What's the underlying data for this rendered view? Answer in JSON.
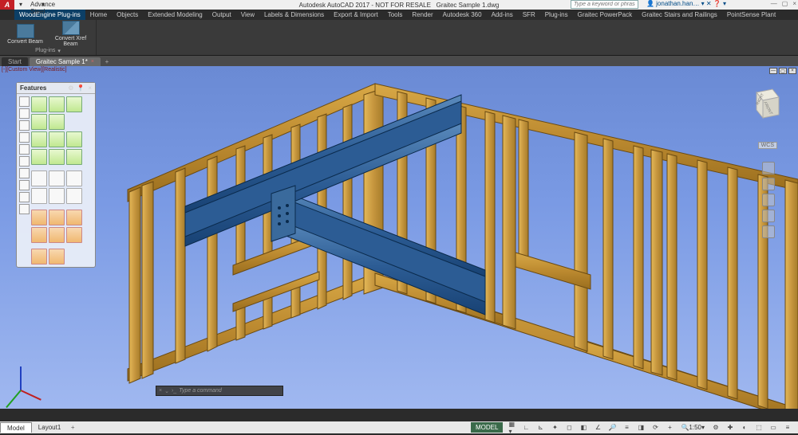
{
  "title": {
    "logo": "A",
    "qat_text": "Advance Steel",
    "app": "Autodesk AutoCAD 2017 - NOT FOR RESALE",
    "file": "Graitec Sample 1.dwg",
    "search_placeholder": "Type a keyword or phrase",
    "user": "jonathan.han…",
    "win_min": "—",
    "win_max": "▢",
    "win_close": "×"
  },
  "ribbon_tabs": [
    "WoodEngine Plug-ins",
    "Home",
    "Objects",
    "Extended Modeling",
    "Output",
    "View",
    "Labels & Dimensions",
    "Export & Import",
    "Tools",
    "Render",
    "Autodesk 360",
    "Add-ins",
    "SFR",
    "Plug-ins",
    "Graitec PowerPack",
    "Graitec Stairs and Railings",
    "PointSense Plant"
  ],
  "ribbon_tabs_active": 0,
  "ribbon": {
    "buttons": [
      {
        "label": "Convert Beam"
      },
      {
        "label": "Convert Xref Beam"
      }
    ],
    "panel_title": "Plug-ins",
    "panel_arrow": "▾"
  },
  "doc_tabs": {
    "items": [
      {
        "label": "Start",
        "active": false,
        "closable": false
      },
      {
        "label": "Graitec Sample 1*",
        "active": true,
        "closable": true
      }
    ],
    "plus": "+"
  },
  "viewport": {
    "controls": "[-][Custom View][Realistic]",
    "viewcube": {
      "front": "FRONT",
      "right": "RIGHT",
      "top": ""
    },
    "wcs": "WCS"
  },
  "features": {
    "title": "Features",
    "gear": "⚙",
    "pin": "📌",
    "close": "×"
  },
  "cmdline": {
    "prompt": "Type a command",
    "chevron": "›_"
  },
  "model_tabs": [
    "Model",
    "Layout1"
  ],
  "model_tabs_active": 0,
  "status": {
    "mode": "MODEL",
    "scale": "1:50",
    "gear": "⚙",
    "menu": "≡"
  }
}
